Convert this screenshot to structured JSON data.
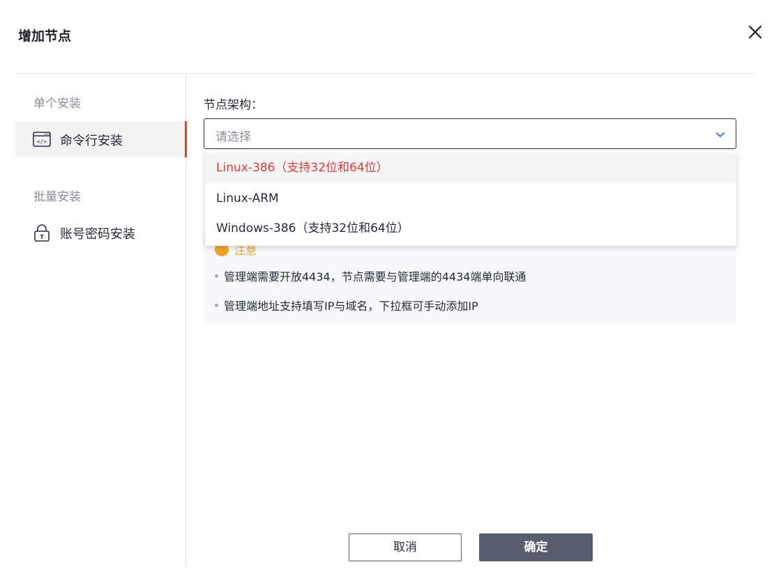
{
  "dialog": {
    "title": "增加节点",
    "close_icon": "close-icon"
  },
  "sidebar": {
    "groups": [
      {
        "label": "单个安装",
        "items": [
          {
            "label": "命令行安装",
            "icon": "terminal-icon",
            "active": true
          }
        ]
      },
      {
        "label": "批量安装",
        "items": [
          {
            "label": "账号密码安装",
            "icon": "lock-icon",
            "active": false
          }
        ]
      }
    ]
  },
  "form": {
    "arch_label": "节点架构：",
    "arch_select": {
      "placeholder": "请选择",
      "options": [
        "Linux-386（支持32位和64位）",
        "Linux-ARM",
        "Windows-386（支持32位和64位）"
      ],
      "highlighted_option": "Linux-386（支持32位和64位）"
    }
  },
  "notice": {
    "title": "注意",
    "items": [
      "管理端需要开放4434，节点需要与管理端的4434端单向联通",
      "管理端地址支持填写IP与域名，下拉框可手动添加IP"
    ]
  },
  "footer": {
    "cancel_label": "取消",
    "ok_label": "确定"
  },
  "colors": {
    "accent_red": "#e03a3a",
    "primary_button": "#575d6c",
    "caret_blue": "#5e7ce0",
    "notice_orange": "#f0a12c"
  }
}
